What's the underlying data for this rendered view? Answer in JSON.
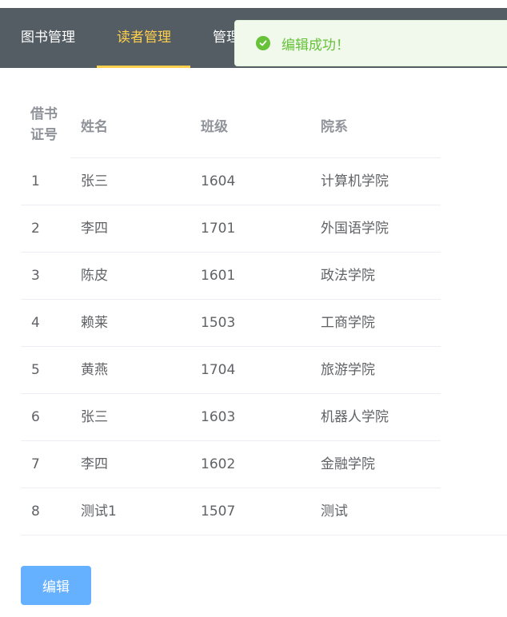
{
  "nav": {
    "items": [
      {
        "label": "图书管理"
      },
      {
        "label": "读者管理"
      },
      {
        "label": "管理"
      }
    ],
    "active_color": "#ffd04b",
    "background": "#545c64"
  },
  "toast": {
    "message": "编辑成功！",
    "icon": "check-circle-icon",
    "color": "#67c23a"
  },
  "table": {
    "headers": {
      "id_line1": "借书",
      "id_line2": "证号",
      "name": "姓名",
      "class": "班级",
      "dept": "院系"
    },
    "rows": [
      {
        "id": "1",
        "name": "张三",
        "class": "1604",
        "dept": "计算机学院"
      },
      {
        "id": "2",
        "name": "李四",
        "class": "1701",
        "dept": "外国语学院"
      },
      {
        "id": "3",
        "name": "陈皮",
        "class": "1601",
        "dept": "政法学院"
      },
      {
        "id": "4",
        "name": "赖莱",
        "class": "1503",
        "dept": "工商学院"
      },
      {
        "id": "5",
        "name": "黄燕",
        "class": "1704",
        "dept": "旅游学院"
      },
      {
        "id": "6",
        "name": "张三",
        "class": "1603",
        "dept": "机器人学院"
      },
      {
        "id": "7",
        "name": "李四",
        "class": "1602",
        "dept": "金融学院"
      },
      {
        "id": "8",
        "name": "测试1",
        "class": "1507",
        "dept": "测试"
      }
    ]
  },
  "actions": {
    "edit_label": "编辑",
    "button_color": "#66b1ff"
  }
}
